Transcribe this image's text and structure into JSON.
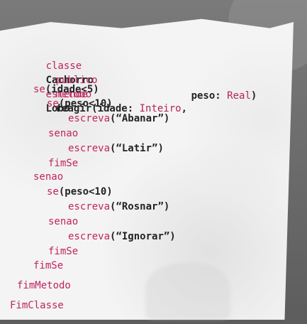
{
  "code": {
    "lines": [
      "classe Cachorro estende Lobo",
      "publico metodo reagir(idade: Inteiro,",
      "peso: Real)",
      "se(idade<5)",
      "se(peso<10)",
      "escreva(“Abanar”)",
      "senao",
      "escreva(“Latir”)",
      "fimSe",
      "senao",
      "se(peso<10)",
      "escreva(“Rosnar”)",
      "senao",
      "escreva(“Ignorar”)",
      "fimSe",
      "fimSe",
      "fimMetodo",
      "FimClasse"
    ]
  }
}
